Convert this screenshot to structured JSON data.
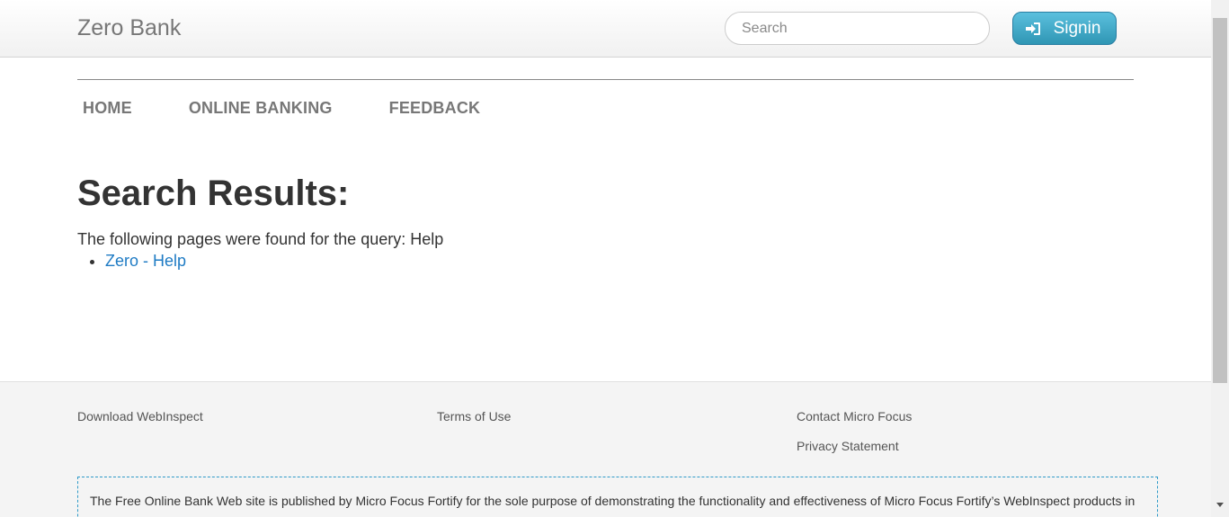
{
  "header": {
    "brand": "Zero Bank",
    "search_placeholder": "Search",
    "signin_label": "Signin"
  },
  "nav": {
    "items": [
      "HOME",
      "ONLINE BANKING",
      "FEEDBACK"
    ]
  },
  "main": {
    "title": "Search Results:",
    "results_text": "The following pages were found for the query: Help",
    "results": [
      "Zero - Help"
    ]
  },
  "footer": {
    "links": {
      "download": "Download WebInspect",
      "terms": "Terms of Use",
      "contact": "Contact Micro Focus",
      "privacy": "Privacy Statement"
    },
    "disclaimer": "The Free Online Bank Web site is published by Micro Focus Fortify for the sole purpose of demonstrating the functionality and effectiveness of Micro Focus Fortify’s WebInspect products in"
  },
  "colors": {
    "accent": "#2f96b4",
    "link": "#1e7bc4",
    "nav_text": "#777777"
  }
}
